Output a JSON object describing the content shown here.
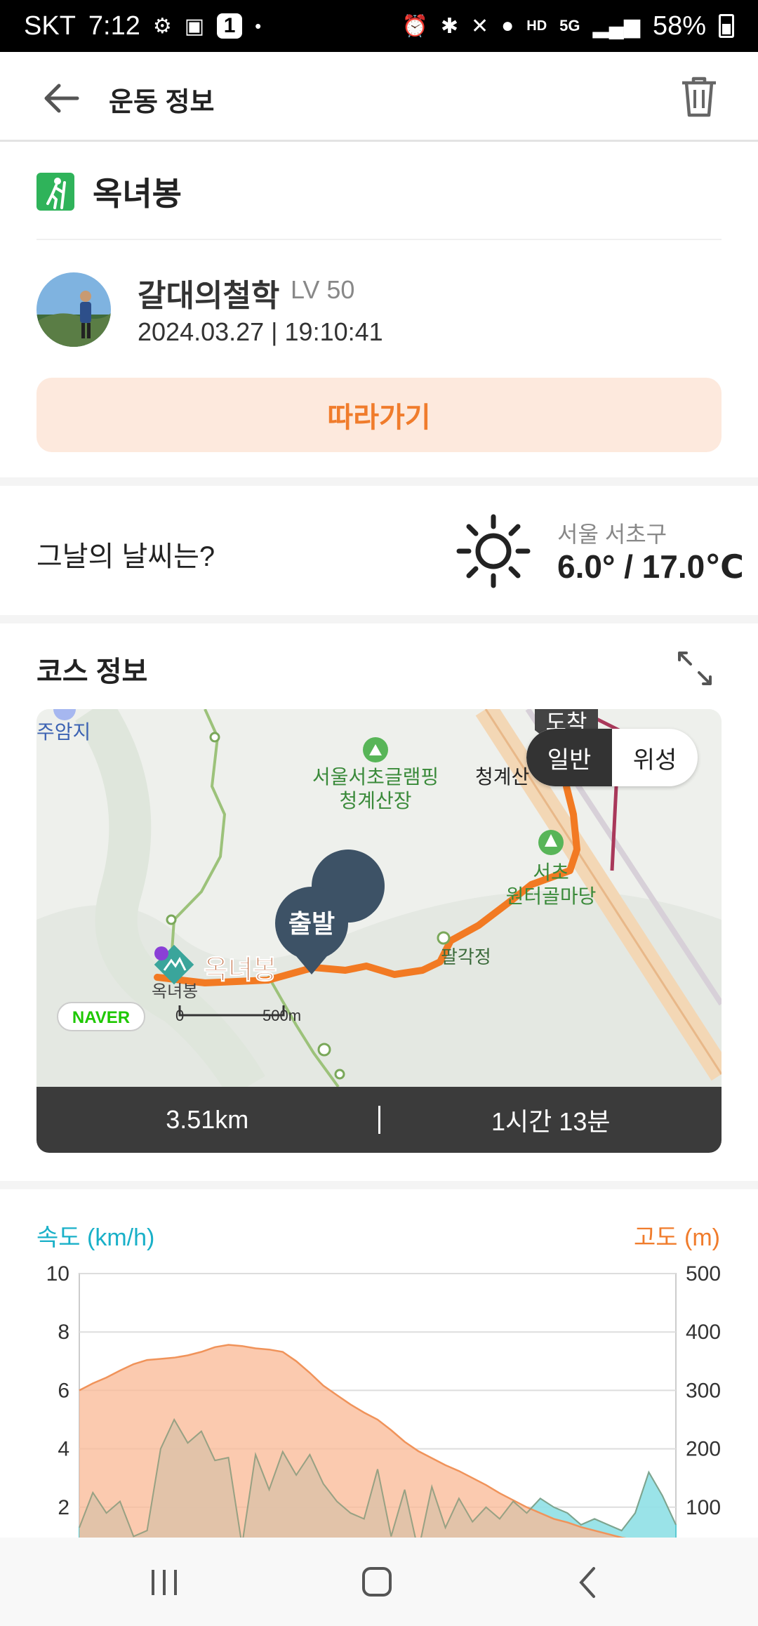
{
  "status_bar": {
    "carrier": "SKT",
    "time": "7:12",
    "badge": "1",
    "battery": "58%",
    "network": "5G",
    "hd_label": "HD"
  },
  "header": {
    "title": "운동 정보",
    "back_icon": "arrow-left-icon",
    "delete_icon": "trash-icon"
  },
  "course": {
    "name": "옥녀봉",
    "activity_icon": "hiking-icon"
  },
  "user": {
    "name": "갈대의철학",
    "level": "LV 50",
    "datetime": "2024.03.27 | 19:10:41"
  },
  "follow_button": "따라가기",
  "weather": {
    "label": "그날의 날씨는?",
    "location": "서울 서초구",
    "temperature": "6.0° / 17.0℃",
    "icon": "sun-icon"
  },
  "course_info": {
    "title": "코스 정보",
    "map": {
      "toggle_options": [
        "일반",
        "위성"
      ],
      "selected": "일반",
      "start_marker": "출발",
      "end_marker_partial": "도착",
      "labels": {
        "juamji": "주암지",
        "glamping": "서울서초글램핑\n청계산장",
        "cheonggye": "청계산",
        "winter": "서초\n원터골마당",
        "palgak": "팔각정",
        "oknyeo_big": "옥녀봉",
        "oknyeo_small": "옥녀봉",
        "scale_zero": "0",
        "scale_500": "500m",
        "brand": "NAVER"
      }
    },
    "distance": "3.51km",
    "duration": "1시간 13분"
  },
  "chart_data": {
    "type": "area",
    "left_axis_label": "속도 (km/h)",
    "right_axis_label": "고도 (m)",
    "left_ticks": [
      "10",
      "8",
      "6",
      "4",
      "2"
    ],
    "right_ticks": [
      "500",
      "400",
      "300",
      "200",
      "100"
    ],
    "left_range": [
      0,
      10
    ],
    "right_range": [
      0,
      500
    ],
    "grid": true,
    "series": [
      {
        "name": "고도 (m)",
        "axis": "right",
        "color": "#f9b894",
        "values": [
          300,
          312,
          322,
          334,
          345,
          352,
          354,
          356,
          360,
          366,
          374,
          378,
          376,
          372,
          370,
          366,
          350,
          330,
          308,
          292,
          276,
          262,
          250,
          232,
          212,
          196,
          184,
          172,
          162,
          150,
          138,
          124,
          112,
          100,
          90,
          80,
          74,
          66,
          60,
          54,
          48,
          44,
          40,
          34,
          30
        ]
      },
      {
        "name": "속도 (km/h)",
        "axis": "left",
        "color": "#8fe0e6",
        "values": [
          1.3,
          2.5,
          1.8,
          2.2,
          1.0,
          1.2,
          4.0,
          5.0,
          4.2,
          4.6,
          3.6,
          3.7,
          0.7,
          3.8,
          2.6,
          3.9,
          3.1,
          3.8,
          2.8,
          2.2,
          1.8,
          1.6,
          3.3,
          1.0,
          2.6,
          0.5,
          2.7,
          1.3,
          2.3,
          1.5,
          2.0,
          1.6,
          2.2,
          1.8,
          2.3,
          2.0,
          1.8,
          1.4,
          1.6,
          1.4,
          1.2,
          1.8,
          3.2,
          2.4,
          1.4
        ]
      }
    ]
  },
  "nav_bar": {
    "recent_icon": "recent-apps-icon",
    "home_icon": "home-icon",
    "back_icon": "nav-back-icon"
  }
}
